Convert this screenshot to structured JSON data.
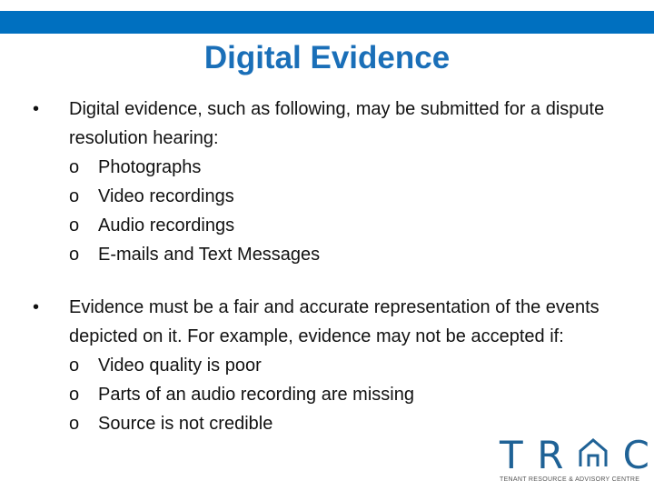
{
  "slide": {
    "title": "Digital Evidence",
    "accent_color": "#0070c0",
    "title_color": "#1a6fb8"
  },
  "bullets": [
    {
      "marker": "•",
      "text": "Digital evidence, such as following, may be submitted for a dispute resolution hearing:",
      "sub": [
        {
          "marker": "o",
          "text": "Photographs"
        },
        {
          "marker": "o",
          "text": "Video recordings"
        },
        {
          "marker": "o",
          "text": "Audio recordings"
        },
        {
          "marker": "o",
          "text": "E-mails and Text Messages"
        }
      ]
    },
    {
      "marker": "•",
      "text": "Evidence must be a fair and accurate representation of the events depicted on it.  For example, evidence may not be accepted if:",
      "sub": [
        {
          "marker": "o",
          "text": "Video quality is poor"
        },
        {
          "marker": "o",
          "text": "Parts of an audio recording are missing"
        },
        {
          "marker": "o",
          "text": "Source is not credible"
        }
      ]
    }
  ],
  "logo": {
    "letters": [
      "T",
      "R",
      "⌂",
      "C"
    ],
    "tagline": "TENANT RESOURCE & ADVISORY CENTRE",
    "color": "#1f6296"
  }
}
